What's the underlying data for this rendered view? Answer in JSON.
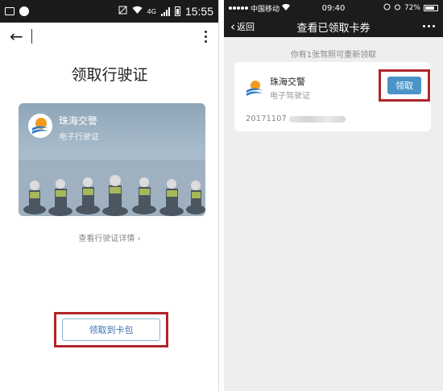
{
  "left": {
    "status_bar": {
      "time": "15:55",
      "network": "4G"
    },
    "title": "领取行驶证",
    "card": {
      "org": "珠海交警",
      "type": "电子行驶证"
    },
    "detail_link": "查看行驶证详情 ›",
    "collect_button": "领取到卡包"
  },
  "right": {
    "status_bar": {
      "carrier": "中国移动",
      "time": "09:40",
      "battery": "72%"
    },
    "nav": {
      "back_label": "返回",
      "title": "查看已领取卡券"
    },
    "hint": "你有1张驾照可重新领取",
    "coupon": {
      "org": "珠海交警",
      "type": "电子驾驶证",
      "serial_prefix": "20171107",
      "claim_label": "领取"
    }
  },
  "colors": {
    "highlight": "#b0252a",
    "claim_button": "#4a94c8",
    "accent_link": "#3a73b4"
  },
  "icons": [
    "image-icon",
    "chat-icon",
    "mute-icon",
    "wifi-icon",
    "signal-icon",
    "battery-icon",
    "back-arrow-icon",
    "more-vertical-icon",
    "traffic-police-logo-icon",
    "chevron-left-icon",
    "more-horizontal-icon"
  ]
}
